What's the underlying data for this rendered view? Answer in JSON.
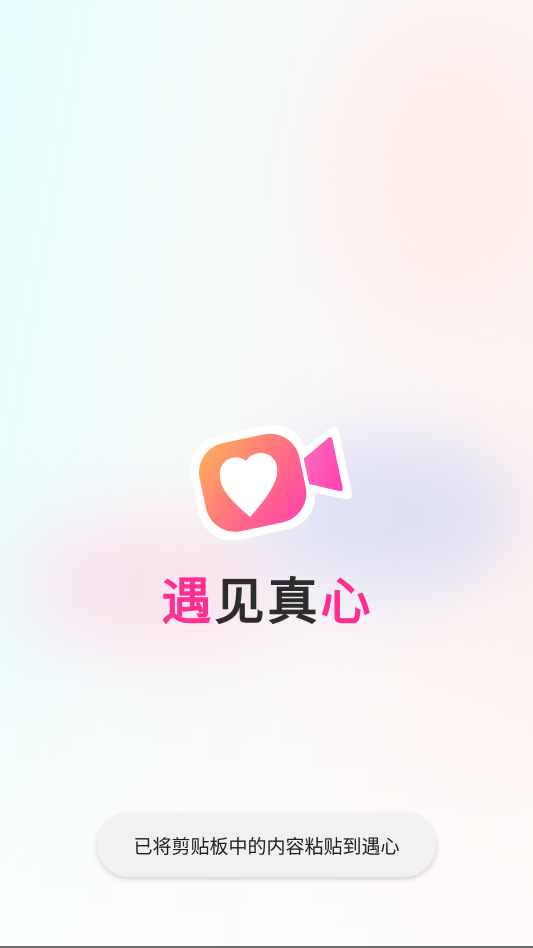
{
  "app": {
    "name_parts": [
      {
        "text": "遇",
        "color": "#ff2f92"
      },
      {
        "text": "见真",
        "color": "#2c2c2c"
      },
      {
        "text": "心",
        "color": "#ff2f92"
      }
    ],
    "logo_icon": "heart-video-camera-icon"
  },
  "toast": {
    "message": "已将剪贴板中的内容粘贴到遇心"
  },
  "colors": {
    "brand_pink": "#ff2f92",
    "brand_orange": "#ff9a4a",
    "text_dark": "#2c2c2c"
  }
}
